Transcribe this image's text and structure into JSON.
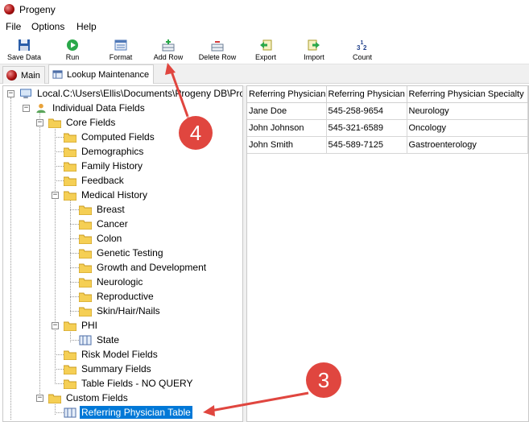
{
  "window": {
    "title": "Progeny"
  },
  "menu": {
    "items": [
      "File",
      "Options",
      "Help"
    ]
  },
  "toolbar": {
    "buttons": [
      {
        "label": "Save Data",
        "icon": "save-icon"
      },
      {
        "label": "Run",
        "icon": "run-icon"
      },
      {
        "label": "Format",
        "icon": "format-icon"
      },
      {
        "label": "Add Row",
        "icon": "add-row-icon"
      },
      {
        "label": "Delete Row",
        "icon": "delete-row-icon"
      },
      {
        "label": "Export",
        "icon": "export-icon"
      },
      {
        "label": "Import",
        "icon": "import-icon"
      },
      {
        "label": "Count",
        "icon": "count-icon"
      }
    ]
  },
  "tabs": [
    {
      "label": "Main",
      "active": false
    },
    {
      "label": "Lookup Maintenance",
      "active": true
    }
  ],
  "tree": {
    "root": "Local.C:\\Users\\Ellis\\Documents\\Progeny DB\\Pro",
    "individual": "Individual Data Fields",
    "core": "Core Fields",
    "computed": "Computed Fields",
    "demographics": "Demographics",
    "family_history": "Family History",
    "feedback": "Feedback",
    "medical_history": "Medical History",
    "medical_children": [
      "Breast",
      "Cancer",
      "Colon",
      "Genetic Testing",
      "Growth and Development",
      "Neurologic",
      "Reproductive",
      "Skin/Hair/Nails"
    ],
    "phi": "PHI",
    "state": "State",
    "risk_model": "Risk Model Fields",
    "summary": "Summary Fields",
    "table_fields": "Table Fields - NO QUERY",
    "custom": "Custom Fields",
    "referring_table": "Referring Physician Table"
  },
  "grid": {
    "columns": [
      "Referring Physician",
      "Referring Physician",
      "Referring Physician Specialty"
    ],
    "rows": [
      [
        "Jane Doe",
        "545-258-9654",
        "Neurology"
      ],
      [
        "John Johnson",
        "545-321-6589",
        "Oncology"
      ],
      [
        "John Smith",
        "545-589-7125",
        "Gastroenterology"
      ]
    ]
  },
  "annotations": {
    "callout_3": "3",
    "callout_4": "4"
  },
  "colors": {
    "selection": "#0078d7",
    "callout": "#e0463f",
    "folder": "#f5cf55"
  }
}
